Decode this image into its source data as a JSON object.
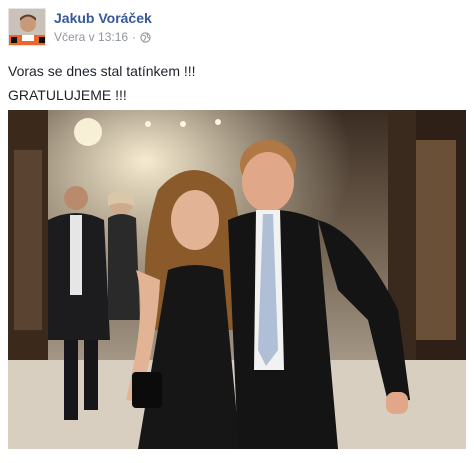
{
  "post": {
    "author": "Jakub Voráček",
    "timestamp": "Včera v 13:16",
    "separator": "·",
    "privacy_icon": "globe-icon",
    "text_lines": [
      "Voras se dnes stal tatínkem !!!",
      "GRATULUJEME !!!"
    ],
    "photo_icon": "photo"
  },
  "colors": {
    "author": "#365899",
    "meta": "#90949c",
    "text": "#1d2129"
  }
}
